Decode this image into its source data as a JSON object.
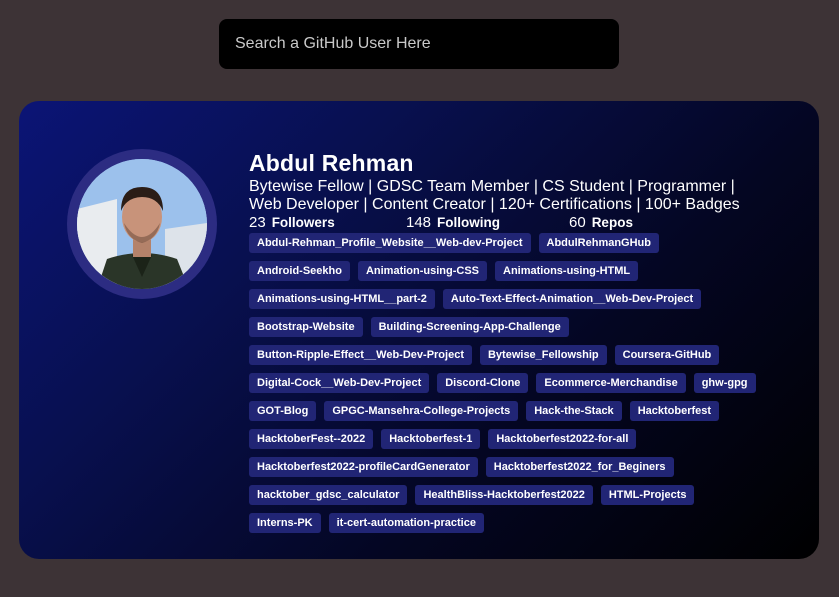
{
  "search": {
    "placeholder": "Search a GitHub User Here"
  },
  "profile": {
    "name": "Abdul Rehman",
    "bio": "Bytewise Fellow | GDSC Team Member | CS Student | Programmer | Web Developer | Content Creator | 120+ Certifications | 100+ Badges",
    "followers_count": "23",
    "followers_label": "Followers",
    "following_count": "148",
    "following_label": "Following",
    "repos_count": "60",
    "repos_label": "Repos"
  },
  "repos": [
    "Abdul-Rehman_Profile_Website__Web-dev-Project",
    "AbdulRehmanGHub",
    "Android-Seekho",
    "Animation-using-CSS",
    "Animations-using-HTML",
    "Animations-using-HTML__part-2",
    "Auto-Text-Effect-Animation__Web-Dev-Project",
    "Bootstrap-Website",
    "Building-Screening-App-Challenge",
    "Button-Ripple-Effect__Web-Dev-Project",
    "Bytewise_Fellowship",
    "Coursera-GitHub",
    "Digital-Cock__Web-Dev-Project",
    "Discord-Clone",
    "Ecommerce-Merchandise",
    "ghw-gpg",
    "GOT-Blog",
    "GPGC-Mansehra-College-Projects",
    "Hack-the-Stack",
    "Hacktoberfest",
    "HacktoberFest--2022",
    "Hacktoberfest-1",
    "Hacktoberfest2022-for-all",
    "Hacktoberfest2022-profileCardGenerator",
    "Hacktoberfest2022_for_Beginers",
    "hacktober_gdsc_calculator",
    "HealthBliss-Hacktoberfest2022",
    "HTML-Projects",
    "Interns-PK",
    "it-cert-automation-practice"
  ]
}
